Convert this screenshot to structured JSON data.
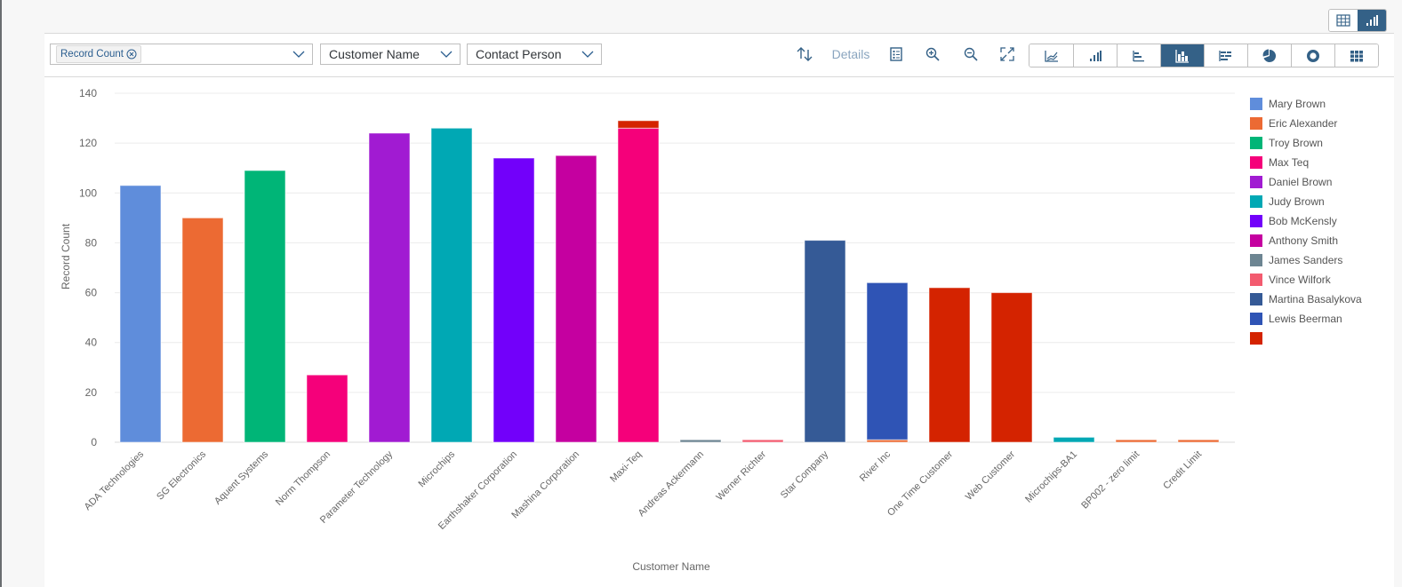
{
  "view_toggle": {
    "table_icon": "table-view-icon",
    "chart_icon": "chart-view-icon",
    "active": "chart"
  },
  "toolbar": {
    "measures_token": "Record Count",
    "dimension_1": "Customer Name",
    "dimension_2": "Contact Person",
    "sort_icon": "sort-icon",
    "details_label": "Details",
    "legend_icon": "legend-icon",
    "zoom_in_icon": "zoom-in-icon",
    "zoom_out_icon": "zoom-out-icon",
    "fullscreen_icon": "fullscreen-icon",
    "chart_types": [
      {
        "name": "line-chart",
        "active": false
      },
      {
        "name": "column-chart",
        "active": false
      },
      {
        "name": "bar-chart",
        "active": false
      },
      {
        "name": "stacked-column-chart",
        "active": true
      },
      {
        "name": "stacked-bar-chart",
        "active": false
      },
      {
        "name": "pie-chart",
        "active": false
      },
      {
        "name": "donut-chart",
        "active": false
      },
      {
        "name": "heatmap-chart",
        "active": false
      }
    ]
  },
  "chart_data": {
    "type": "bar",
    "stacked": true,
    "title": "",
    "xlabel": "Customer Name",
    "ylabel": "Record Count",
    "ylim": [
      0,
      140
    ],
    "yticks": [
      0,
      20,
      40,
      60,
      80,
      100,
      120,
      140
    ],
    "grid": true,
    "legend_position": "right",
    "categories": [
      "ADA Technologies",
      "SG Electronics",
      "Aquent Systems",
      "Norm Thompson",
      "Parameter Technology",
      "Microchips",
      "Earthshaker Corporation",
      "Mashina Corporation",
      "Maxi-Teq",
      "Andreas Ackermann",
      "Werner Richter",
      "Star Company",
      "River Inc",
      "One Time Customer",
      "Web Customer",
      "Microchips-BA1",
      "BP002 - zero limit",
      "Credit Limit"
    ],
    "series": [
      {
        "name": "Mary Brown",
        "color": "#5f8ddb",
        "values": [
          103,
          0,
          0,
          0,
          0,
          0,
          0,
          0,
          0,
          0,
          0,
          0,
          0,
          0,
          0,
          0,
          0,
          0
        ]
      },
      {
        "name": "Eric Alexander",
        "color": "#ec6a33",
        "values": [
          0,
          90,
          0,
          0,
          0,
          0,
          0,
          0,
          0,
          0,
          0,
          0,
          1,
          0,
          0,
          0,
          1,
          1
        ]
      },
      {
        "name": "Troy Brown",
        "color": "#00b577",
        "values": [
          0,
          0,
          109,
          0,
          0,
          0,
          0,
          0,
          0,
          0,
          0,
          0,
          0,
          0,
          0,
          0,
          0,
          0
        ]
      },
      {
        "name": "Max Teq",
        "color": "#f5007a",
        "values": [
          0,
          0,
          0,
          27,
          0,
          0,
          0,
          0,
          126,
          0,
          0,
          0,
          0,
          0,
          0,
          0,
          0,
          0
        ]
      },
      {
        "name": "Daniel Brown",
        "color": "#a11bd2",
        "values": [
          0,
          0,
          0,
          0,
          124,
          0,
          0,
          0,
          0,
          0,
          0,
          0,
          0,
          0,
          0,
          0,
          0,
          0
        ]
      },
      {
        "name": "Judy Brown",
        "color": "#00a8b4",
        "values": [
          0,
          0,
          0,
          0,
          0,
          126,
          0,
          0,
          0,
          0,
          0,
          0,
          0,
          0,
          0,
          2,
          0,
          0
        ]
      },
      {
        "name": "Bob McKensly",
        "color": "#7200fa",
        "values": [
          0,
          0,
          0,
          0,
          0,
          0,
          114,
          0,
          0,
          0,
          0,
          0,
          0,
          0,
          0,
          0,
          0,
          0
        ]
      },
      {
        "name": "Anthony Smith",
        "color": "#c500a0",
        "values": [
          0,
          0,
          0,
          0,
          0,
          0,
          0,
          115,
          0,
          0,
          0,
          0,
          0,
          0,
          0,
          0,
          0,
          0
        ]
      },
      {
        "name": "James Sanders",
        "color": "#6d8592",
        "values": [
          0,
          0,
          0,
          0,
          0,
          0,
          0,
          0,
          0,
          1,
          0,
          0,
          0,
          0,
          0,
          0,
          0,
          0
        ]
      },
      {
        "name": "Vince Wilfork",
        "color": "#f35b6f",
        "values": [
          0,
          0,
          0,
          0,
          0,
          0,
          0,
          0,
          0,
          0,
          1,
          0,
          0,
          0,
          0,
          0,
          0,
          0
        ]
      },
      {
        "name": "Martina Basalykova",
        "color": "#355a96",
        "values": [
          0,
          0,
          0,
          0,
          0,
          0,
          0,
          0,
          0,
          0,
          0,
          81,
          0,
          0,
          0,
          0,
          0,
          0
        ]
      },
      {
        "name": "Lewis Beerman",
        "color": "#2f54b5",
        "values": [
          0,
          0,
          0,
          0,
          0,
          0,
          0,
          0,
          0,
          0,
          0,
          0,
          63,
          0,
          0,
          0,
          0,
          0
        ]
      },
      {
        "name": "",
        "color": "#d42300",
        "values": [
          0,
          0,
          0,
          0,
          0,
          0,
          0,
          0,
          3,
          0,
          0,
          0,
          0,
          62,
          60,
          0,
          0,
          0
        ]
      }
    ]
  },
  "colors": {
    "accent": "#346187",
    "grid": "#ebebeb",
    "axis_text": "#666666"
  }
}
